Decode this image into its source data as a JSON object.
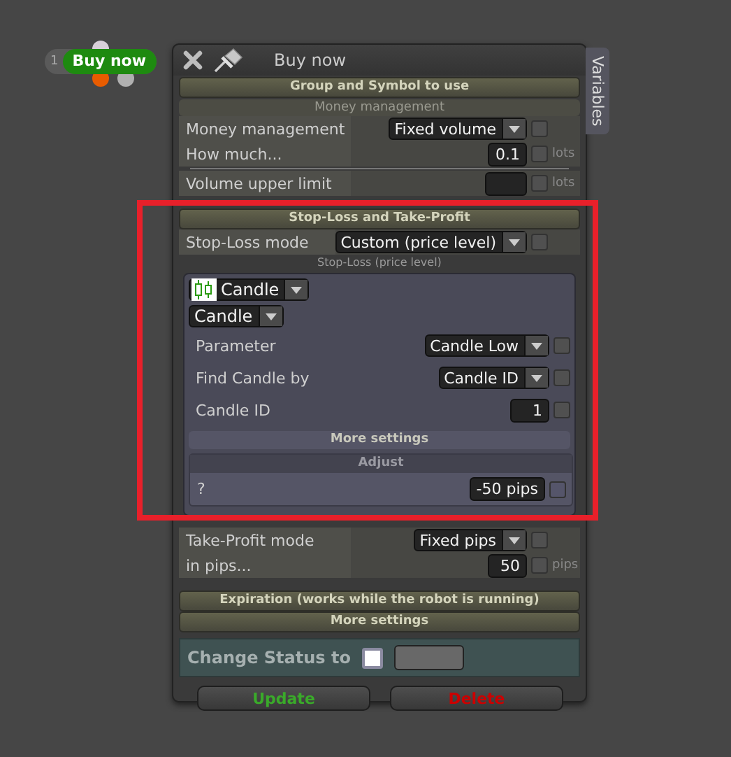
{
  "node": {
    "index": "1",
    "label": "Buy now"
  },
  "window": {
    "title": "Buy now",
    "side_tab": "Variables"
  },
  "items": [
    {
      "kind": "header",
      "text": "Group and Symbol to use"
    },
    {
      "kind": "subheader",
      "text": "Money management"
    },
    {
      "kind": "select",
      "label": "Money management",
      "value": "Fixed volume",
      "checked": false
    },
    {
      "kind": "number",
      "label": "How much...",
      "value": "0.1",
      "unit": "lots",
      "checked": false
    },
    {
      "kind": "divider"
    },
    {
      "kind": "number",
      "label": "Volume upper limit",
      "unit": "lots",
      "checked": false
    },
    {
      "kind": "header",
      "text": "Stop-Loss and Take-Profit"
    },
    {
      "kind": "select",
      "label": "Stop-Loss mode",
      "value": "Custom (price level)",
      "checked": false
    },
    {
      "kind": "note",
      "text": "Stop-Loss (price level)"
    },
    {
      "kind": "panel"
    },
    {
      "kind": "select",
      "label": "Take-Profit mode",
      "value": "Fixed pips",
      "checked": false
    },
    {
      "kind": "number",
      "label": "in pips...",
      "value": "50",
      "unit": "pips",
      "checked": false
    },
    {
      "kind": "header",
      "text": "Expiration (works while the robot is running)"
    },
    {
      "kind": "header",
      "text": "More settings"
    }
  ],
  "panel": {
    "source": "Candle",
    "type": "Candle",
    "rows": [
      {
        "kind": "select",
        "label": "Parameter",
        "value": "Candle Low",
        "checked": false
      },
      {
        "kind": "select",
        "label": "Find Candle by",
        "value": "Candle ID",
        "checked": false
      },
      {
        "kind": "number",
        "label": "Candle ID",
        "value": "1",
        "checked": false
      }
    ],
    "more": "More settings",
    "adjust": {
      "title": "Adjust",
      "label": "?",
      "value": "-50 pips",
      "checked": false
    }
  },
  "status": {
    "label": "Change Status to",
    "checked": false
  },
  "buttons": [
    {
      "kind": "update",
      "label": "Update"
    },
    {
      "kind": "delete",
      "label": "Delete"
    }
  ]
}
